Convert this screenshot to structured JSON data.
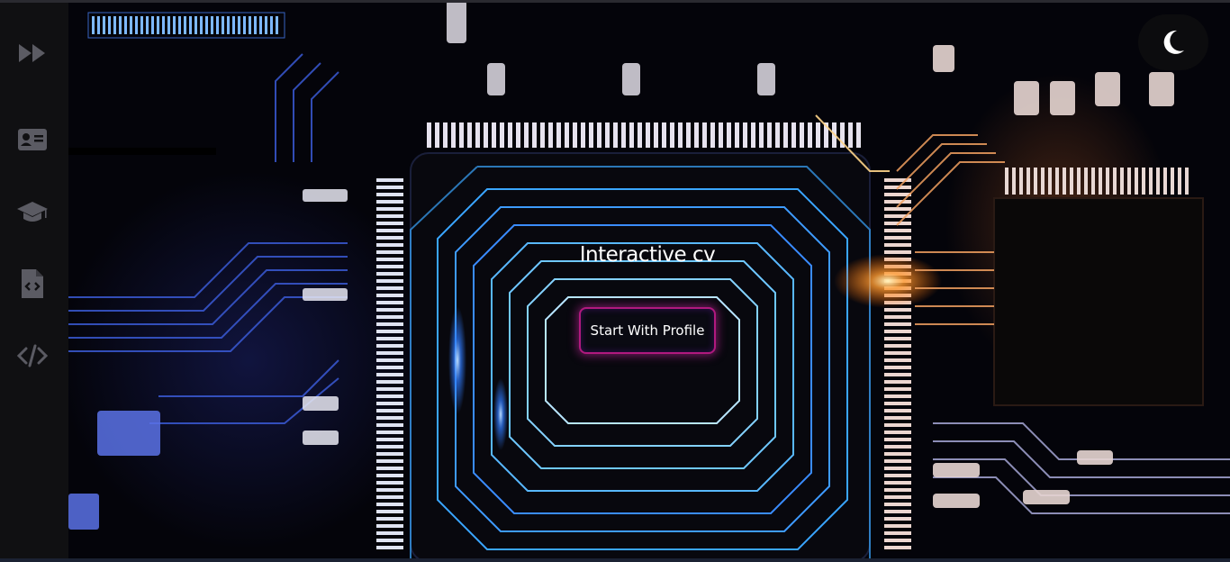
{
  "hero": {
    "title": "Interactive cv",
    "cta_label": "Start With Profile"
  },
  "sidebar": {
    "items": [
      {
        "icon": "fast-forward-icon"
      },
      {
        "icon": "id-card-icon"
      },
      {
        "icon": "graduation-cap-icon"
      },
      {
        "icon": "code-file-icon"
      },
      {
        "icon": "code-icon"
      }
    ]
  },
  "theme_toggle": {
    "icon": "moon-icon"
  },
  "colors": {
    "sidebar": "#101012",
    "icon": "#5b5b63",
    "accent_border": "#b0197e",
    "glow_blue": "#2f7bff",
    "glow_orange": "#ff8a2a"
  }
}
